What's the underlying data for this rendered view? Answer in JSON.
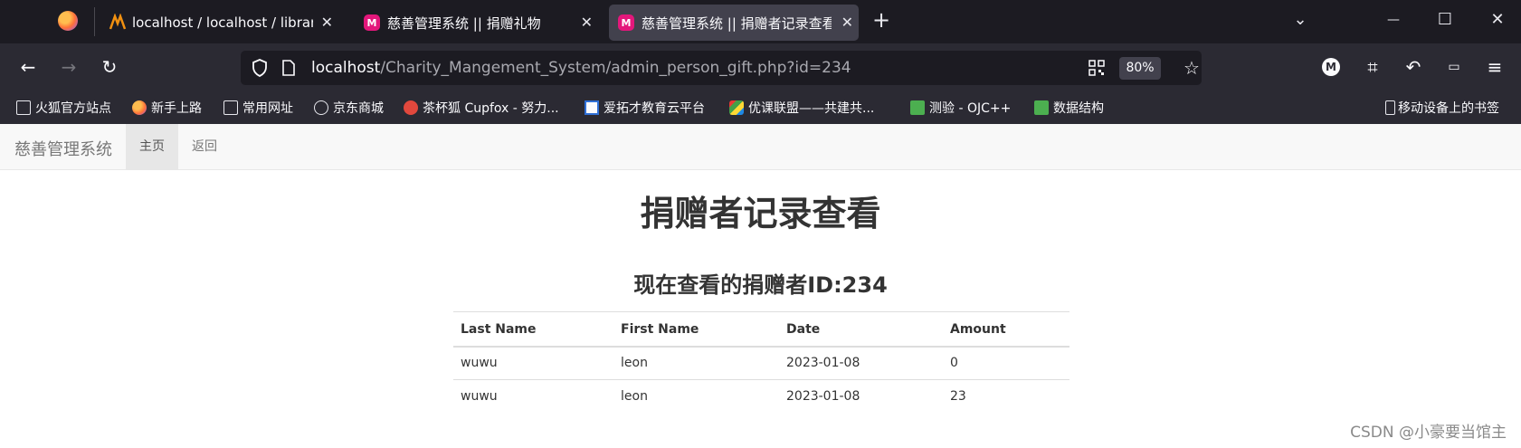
{
  "browser": {
    "tabs": [
      {
        "title": "localhost / localhost / library",
        "close": "✕"
      },
      {
        "title": "慈善管理系统 || 捐赠礼物",
        "close": "✕"
      },
      {
        "title": "慈善管理系统 || 捐赠者记录查看",
        "close": "✕"
      }
    ],
    "new_tab": "+",
    "list_all_tabs": "⌄",
    "window_controls": {
      "minimize": "—",
      "maximize": "☐",
      "close": "✕"
    },
    "url": {
      "host": "localhost",
      "path": "/Charity_Mangement_System/admin_person_gift.php?id=234"
    },
    "zoom": "80%",
    "bookmarks": [
      "火狐官方站点",
      "新手上路",
      "常用网址",
      "京东商城",
      "茶杯狐 Cupfox - 努力...",
      "爱拓才教育云平台",
      "优课联盟——共建共...",
      "测验 - OJC++",
      "数据结构"
    ],
    "mobile_bookmarks": "移动设备上的书签"
  },
  "page": {
    "brand": "慈善管理系统",
    "nav": [
      {
        "label": "主页"
      },
      {
        "label": "返回"
      }
    ],
    "title": "捐赠者记录查看",
    "subtitle": "现在查看的捐赠者ID:234",
    "table": {
      "headers": [
        "Last Name",
        "First Name",
        "Date",
        "Amount"
      ],
      "rows": [
        [
          "wuwu",
          "leon",
          "2023-01-08",
          "0"
        ],
        [
          "wuwu",
          "leon",
          "2023-01-08",
          "23"
        ]
      ]
    }
  },
  "watermark": "CSDN @小豪要当馆主"
}
